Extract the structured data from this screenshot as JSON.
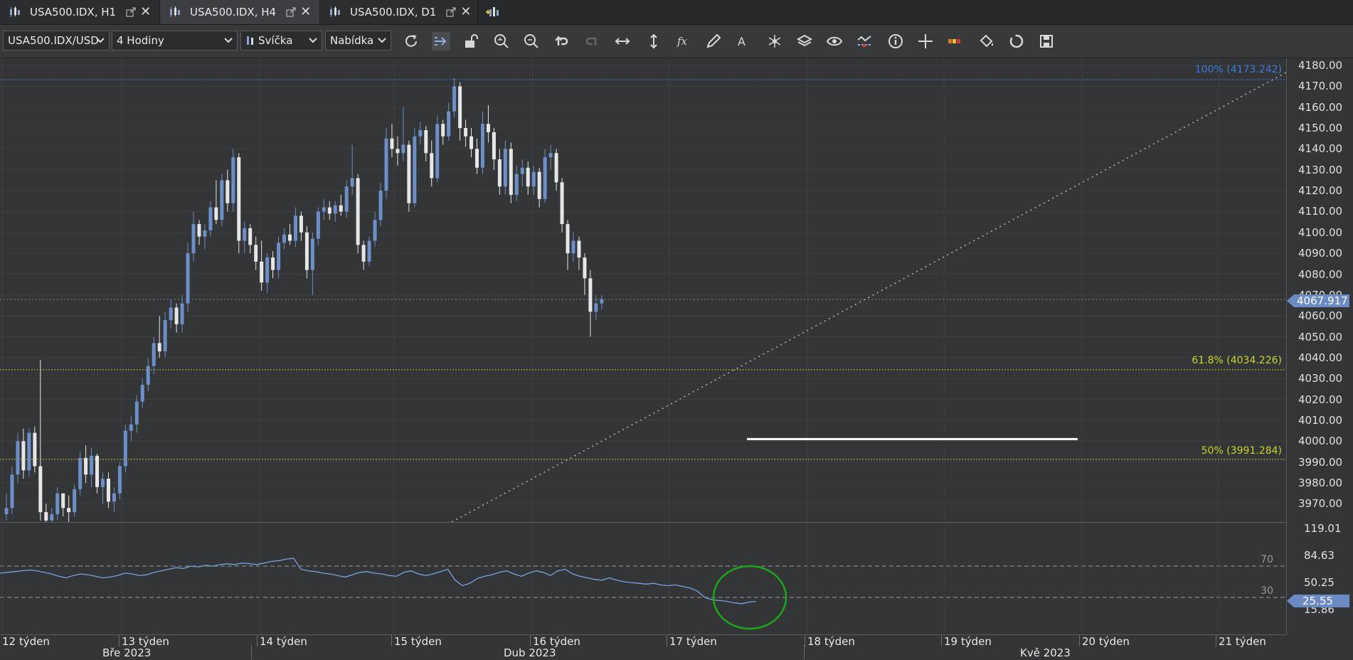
{
  "tabs": [
    {
      "label": "USA500.IDX, H1",
      "active": false
    },
    {
      "label": "USA500.IDX, H4",
      "active": true
    },
    {
      "label": "USA500.IDX, D1",
      "active": false
    }
  ],
  "toolbar": {
    "instrument": "USA500.IDX/USD",
    "period": "4 Hodiny",
    "chart_type": "Svíčka",
    "price_side": "Nabídka"
  },
  "price_axis": {
    "labels": [
      "4180.00",
      "4170.00",
      "4160.00",
      "4150.00",
      "4140.00",
      "4130.00",
      "4120.00",
      "4110.00",
      "4100.00",
      "4090.00",
      "4080.00",
      "4070.00",
      "4060.00",
      "4050.00",
      "4040.00",
      "4030.00",
      "4020.00",
      "4010.00",
      "4000.00",
      "3990.00",
      "3980.00",
      "3970.00"
    ],
    "current_price": "4067.917"
  },
  "fibonacci": {
    "level_100": "100% (4173.242)",
    "level_618": "61.8% (4034.226)",
    "level_50": "50% (3991.284)"
  },
  "indicator": {
    "axis_labels": [
      "119.01",
      "84.63",
      "50.25",
      "15.86"
    ],
    "upper_band": "70",
    "lower_band": "30",
    "current_value": "25.55"
  },
  "time_axis": {
    "weeks": [
      "12 týden",
      "13 týden",
      "14 týden",
      "15 týden",
      "16 týden",
      "17 týden",
      "18 týden",
      "19 týden",
      "20 týden",
      "21 týden"
    ],
    "months": [
      "Bře 2023",
      "Dub 2023",
      "Kvě 2023"
    ]
  },
  "chart_data": {
    "type": "candlestick",
    "y_range": [
      3962,
      4184
    ],
    "candles": [
      [
        3965,
        3975,
        3962,
        3968
      ],
      [
        3968,
        3988,
        3965,
        3984
      ],
      [
        3984,
        4004,
        3980,
        4000
      ],
      [
        4000,
        4006,
        3982,
        3986
      ],
      [
        3986,
        4006,
        3983,
        4004
      ],
      [
        4004,
        4007,
        3985,
        3988
      ],
      [
        3988,
        4039,
        3962,
        3966
      ],
      [
        3966,
        3970,
        3960,
        3962
      ],
      [
        3962,
        3968,
        3955,
        3965
      ],
      [
        3965,
        3978,
        3962,
        3975
      ],
      [
        3975,
        3974,
        3964,
        3968
      ],
      [
        3968,
        3974,
        3960,
        3966
      ],
      [
        3966,
        3979,
        3964,
        3977
      ],
      [
        3977,
        3995,
        3974,
        3992
      ],
      [
        3992,
        3998,
        3980,
        3984
      ],
      [
        3984,
        3997,
        3978,
        3993
      ],
      [
        3993,
        3994,
        3975,
        3978
      ],
      [
        3978,
        3985,
        3970,
        3982
      ],
      [
        3982,
        3985,
        3968,
        3971
      ],
      [
        3971,
        3978,
        3966,
        3975
      ],
      [
        3975,
        3990,
        3972,
        3988
      ],
      [
        3988,
        4008,
        3985,
        4005
      ],
      [
        4005,
        4012,
        4000,
        4008
      ],
      [
        4008,
        4022,
        4004,
        4019
      ],
      [
        4019,
        4030,
        4016,
        4027
      ],
      [
        4027,
        4040,
        4024,
        4036
      ],
      [
        4036,
        4050,
        4032,
        4047
      ],
      [
        4047,
        4060,
        4040,
        4043
      ],
      [
        4043,
        4062,
        4040,
        4058
      ],
      [
        4058,
        4068,
        4054,
        4064
      ],
      [
        4064,
        4066,
        4052,
        4056
      ],
      [
        4056,
        4070,
        4052,
        4066
      ],
      [
        4066,
        4095,
        4062,
        4090
      ],
      [
        4090,
        4110,
        4086,
        4104
      ],
      [
        4104,
        4106,
        4094,
        4098
      ],
      [
        4098,
        4104,
        4092,
        4101
      ],
      [
        4101,
        4115,
        4098,
        4112
      ],
      [
        4112,
        4125,
        4104,
        4106
      ],
      [
        4106,
        4128,
        4103,
        4125
      ],
      [
        4125,
        4130,
        4110,
        4114
      ],
      [
        4114,
        4140,
        4110,
        4136
      ],
      [
        4136,
        4138,
        4090,
        4096
      ],
      [
        4096,
        4105,
        4090,
        4102
      ],
      [
        4102,
        4104,
        4090,
        4094
      ],
      [
        4094,
        4098,
        4082,
        4086
      ],
      [
        4086,
        4096,
        4072,
        4076
      ],
      [
        4076,
        4090,
        4071,
        4088
      ],
      [
        4088,
        4091,
        4078,
        4082
      ],
      [
        4082,
        4098,
        4078,
        4095
      ],
      [
        4095,
        4102,
        4092,
        4099
      ],
      [
        4099,
        4104,
        4094,
        4096
      ],
      [
        4096,
        4112,
        4093,
        4108
      ],
      [
        4108,
        4110,
        4096,
        4100
      ],
      [
        4100,
        4103,
        4078,
        4082
      ],
      [
        4082,
        4100,
        4070,
        4097
      ],
      [
        4097,
        4112,
        4094,
        4110
      ],
      [
        4110,
        4116,
        4106,
        4112
      ],
      [
        4112,
        4115,
        4106,
        4109
      ],
      [
        4109,
        4115,
        4105,
        4113
      ],
      [
        4113,
        4118,
        4108,
        4110
      ],
      [
        4110,
        4125,
        4107,
        4122
      ],
      [
        4122,
        4142,
        4118,
        4126
      ],
      [
        4126,
        4128,
        4090,
        4094
      ],
      [
        4094,
        4096,
        4082,
        4086
      ],
      [
        4086,
        4098,
        4084,
        4096
      ],
      [
        4096,
        4110,
        4093,
        4106
      ],
      [
        4106,
        4124,
        4103,
        4120
      ],
      [
        4120,
        4150,
        4116,
        4145
      ],
      [
        4145,
        4152,
        4136,
        4140
      ],
      [
        4140,
        4146,
        4132,
        4138
      ],
      [
        4138,
        4160,
        4134,
        4142
      ],
      [
        4142,
        4144,
        4110,
        4114
      ],
      [
        4114,
        4150,
        4112,
        4146
      ],
      [
        4146,
        4153,
        4142,
        4149
      ],
      [
        4149,
        4151,
        4134,
        4138
      ],
      [
        4138,
        4144,
        4122,
        4126
      ],
      [
        4126,
        4156,
        4124,
        4152
      ],
      [
        4152,
        4154,
        4142,
        4146
      ],
      [
        4146,
        4162,
        4144,
        4158
      ],
      [
        4158,
        4174,
        4155,
        4170
      ],
      [
        4170,
        4172,
        4144,
        4150
      ],
      [
        4150,
        4154,
        4141,
        4146
      ],
      [
        4146,
        4150,
        4136,
        4140
      ],
      [
        4140,
        4145,
        4128,
        4131
      ],
      [
        4131,
        4158,
        4128,
        4152
      ],
      [
        4152,
        4161,
        4143,
        4148
      ],
      [
        4148,
        4150,
        4130,
        4135
      ],
      [
        4135,
        4140,
        4118,
        4122
      ],
      [
        4122,
        4144,
        4118,
        4140
      ],
      [
        4140,
        4143,
        4114,
        4118
      ],
      [
        4118,
        4132,
        4115,
        4128
      ],
      [
        4128,
        4135,
        4122,
        4131
      ],
      [
        4131,
        4134,
        4118,
        4122
      ],
      [
        4122,
        4132,
        4118,
        4129
      ],
      [
        4129,
        4131,
        4112,
        4116
      ],
      [
        4116,
        4140,
        4114,
        4136
      ],
      [
        4136,
        4142,
        4130,
        4138
      ],
      [
        4138,
        4140,
        4120,
        4124
      ],
      [
        4124,
        4126,
        4100,
        4104
      ],
      [
        4104,
        4106,
        4082,
        4090
      ],
      [
        4090,
        4100,
        4086,
        4096
      ],
      [
        4096,
        4098,
        4082,
        4088
      ],
      [
        4088,
        4090,
        4070,
        4078
      ],
      [
        4078,
        4082,
        4050,
        4062
      ],
      [
        4062,
        4070,
        4058,
        4066
      ],
      [
        4066,
        4070,
        4063,
        4068
      ]
    ],
    "indicator_series": [
      61,
      62,
      63,
      64,
      65,
      64,
      62,
      60,
      57,
      55,
      58,
      60,
      59,
      57,
      55,
      56,
      58,
      61,
      60,
      58,
      59,
      62,
      64,
      66,
      68,
      67,
      70,
      69,
      71,
      70,
      72,
      73,
      72,
      74,
      73,
      72,
      74,
      76,
      77,
      79,
      80,
      66,
      64,
      63,
      61,
      60,
      58,
      56,
      59,
      62,
      63,
      61,
      60,
      58,
      57,
      62,
      64,
      60,
      58,
      60,
      63,
      66,
      52,
      45,
      48,
      54,
      57,
      59,
      62,
      64,
      60,
      57,
      61,
      64,
      62,
      58,
      64,
      66,
      60,
      57,
      55,
      53,
      52,
      55,
      52,
      50,
      49,
      48,
      47,
      48,
      46,
      45,
      46,
      44,
      42,
      38,
      30,
      27,
      26,
      25,
      23,
      22,
      24,
      25
    ]
  }
}
